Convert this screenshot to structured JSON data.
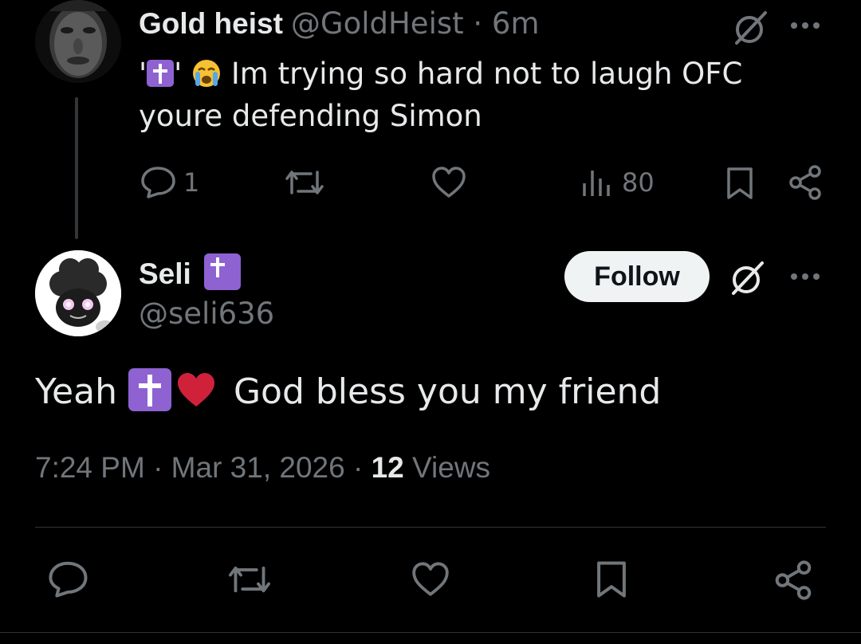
{
  "parent_tweet": {
    "display_name": "Gold heist",
    "handle_time": "@GoldHeist · 6m",
    "text_prefix": "'",
    "text_mid": "'",
    "text_main": " Im trying so hard not to laugh OFC youre defending Simon",
    "replies": "1",
    "views": "80"
  },
  "main_tweet": {
    "display_name": "Seli",
    "handle": "@seli636",
    "follow_label": "Follow",
    "text_before": "Yeah ",
    "text_after": " God bless you my friend",
    "time": "7:24 PM · Mar 31, 2026 · ",
    "views_count": "12",
    "views_label": " Views"
  },
  "colors": {
    "background": "#000000",
    "text": "#e7e9ea",
    "secondary_text": "#71767b",
    "cross_badge": "#8e62d1",
    "heart": "#d0213b"
  },
  "icons": [
    "grok-icon",
    "more-icon",
    "reply-icon",
    "repost-icon",
    "like-icon",
    "views-icon",
    "bookmark-icon",
    "share-icon",
    "cross-emoji",
    "crying-face-emoji",
    "red-heart-emoji"
  ]
}
